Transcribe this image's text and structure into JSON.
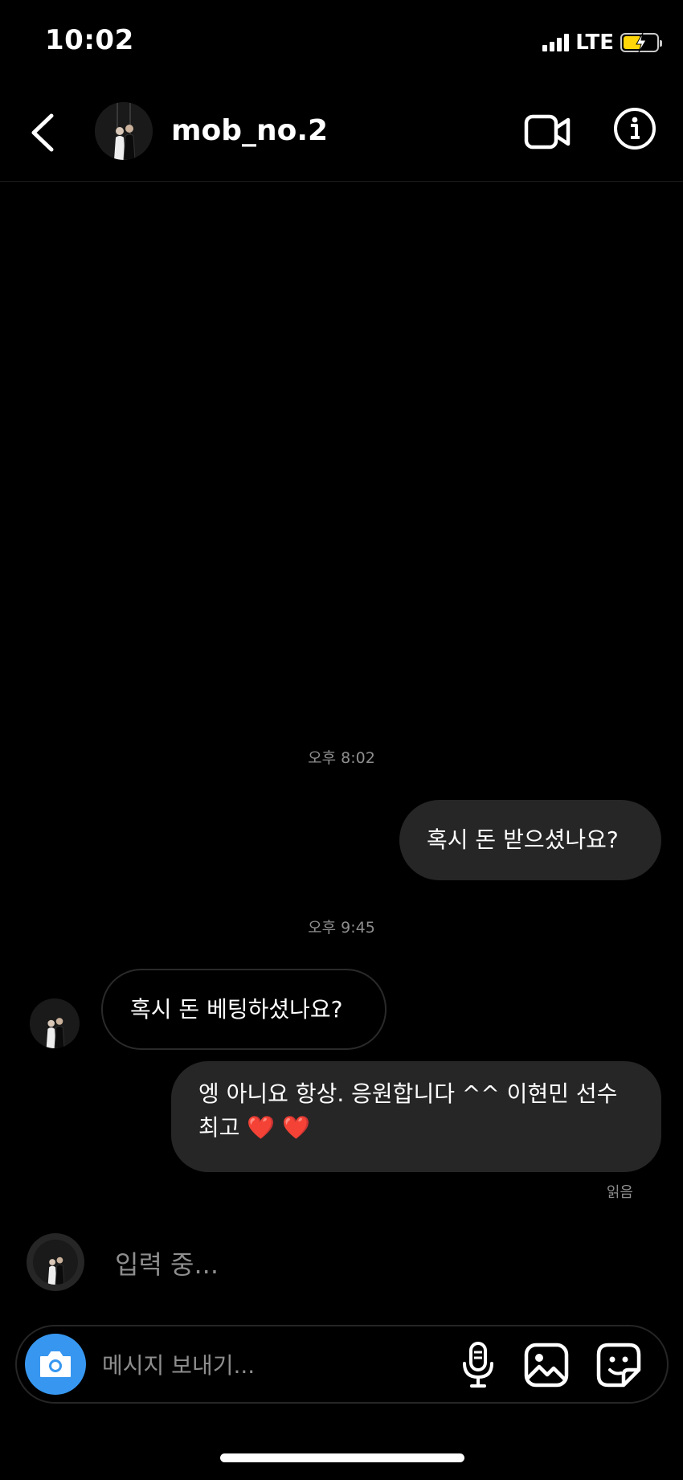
{
  "status_bar": {
    "time": "10:02",
    "network": "LTE"
  },
  "header": {
    "username": "mob_no.2",
    "avatar_icon": "profile-photo-couple",
    "video_call_icon": "video-camera-icon",
    "info_icon": "info-icon"
  },
  "chat": {
    "timestamps": [
      "오후 8:02",
      "오후 9:45"
    ],
    "messages": [
      {
        "direction": "outgoing",
        "text": "혹시 돈 받으셨나요?"
      },
      {
        "direction": "incoming",
        "text": "혹시 돈 베팅하셨나요?"
      },
      {
        "direction": "outgoing",
        "line1": "엥 아니요 항상. 응원합니다 ^^ 이현민 선수",
        "line2": "최고 ❤️ ❤️"
      }
    ],
    "read_receipt": "읽음",
    "typing_indicator": "입력 중..."
  },
  "composer": {
    "placeholder": "메시지 보내기...",
    "value": ""
  },
  "colors": {
    "background": "#000000",
    "bubble_outgoing": "#262626",
    "accent_camera": "#3797f0",
    "battery": "#ffd60a",
    "muted_text": "#8e8e8e"
  }
}
